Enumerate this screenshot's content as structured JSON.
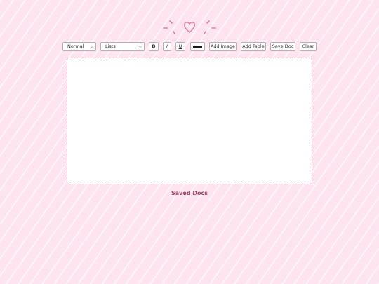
{
  "toolbar": {
    "format_select": {
      "value": "Normal"
    },
    "list_select": {
      "value": "Lists"
    },
    "bold_label": "B",
    "italic_label": "I",
    "underline_label": "U",
    "text_color": "#1a1a1a",
    "add_image_label": "Add Image",
    "add_table_label": "Add Table",
    "save_doc_label": "Save Doc",
    "clear_label": "Clear"
  },
  "editor": {
    "content": ""
  },
  "saved": {
    "title": "Saved Docs"
  },
  "colors": {
    "background": "#fde4ef",
    "accent": "#e07aa3",
    "heading": "#a04060"
  },
  "icons": {
    "logo": "heart-icon"
  }
}
